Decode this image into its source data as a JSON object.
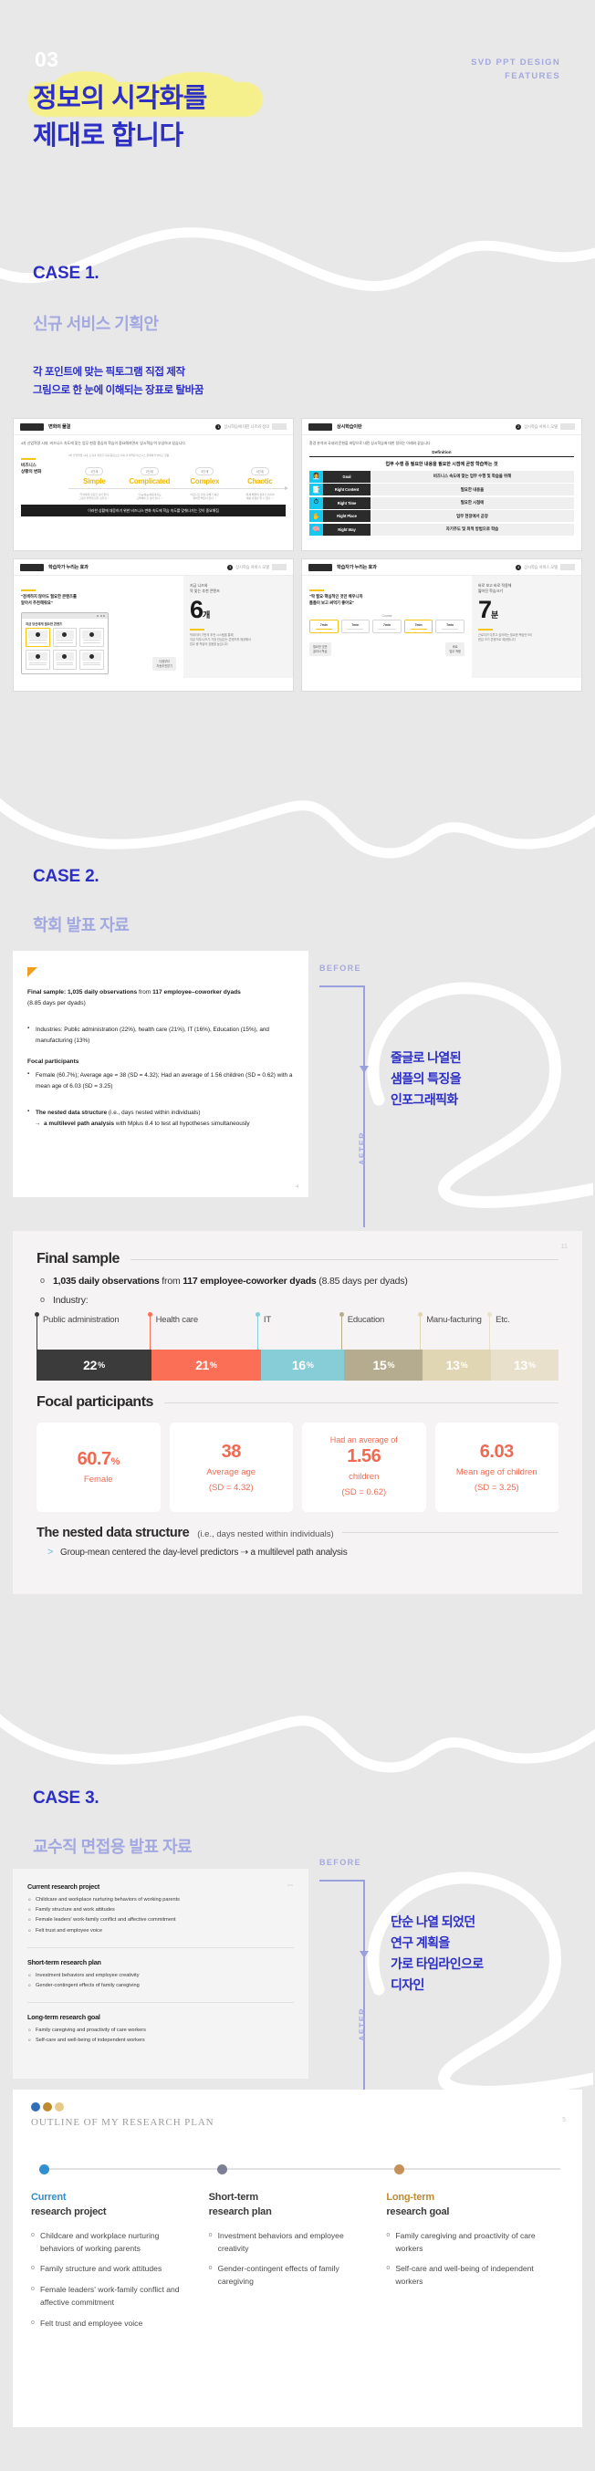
{
  "header": {
    "number": "03",
    "brand_line1": "SVD PPT DESIGN",
    "brand_line2": "FEATURES",
    "hero_line1": "정보의 시각화를",
    "hero_line2": "제대로 합니다"
  },
  "colors": {
    "accent_blue": "#2d2fc4",
    "accent_lavender": "#a3a8e0",
    "highlight_yellow": "#f6f08c",
    "coral": "#ef6a52",
    "teal": "#86cdd8",
    "khaki": "#b5ab8e",
    "sand": "#e0d6b4",
    "dark": "#3b3b3b"
  },
  "case1": {
    "number": "CASE 1.",
    "subtitle": "신규 서비스 기획안",
    "desc_line1": "각 포인트에 맞는 픽토그램 직접 제작",
    "desc_line2": "그림으로 한 눈에  이해되는 장표로 탈바꿈",
    "thumbs": [
      {
        "title": "변화의 물결",
        "badge": "1",
        "badge_label": "상시학습에 대한 니즈와 정의",
        "lead": "4차 산업혁명 시대, 비즈니스 속도에 맞는 업무 현장 중심의 학습이 중요해지면서 '상시학습'이 부상하고 있습니다.",
        "side_label": "비즈니스\n상황의 변화",
        "flow_caption": "4차 산업혁명 시대, 조직과 개인은 다음 중심으로 더욱 더 어려운 비즈니스 문제에 부딪히고 있음",
        "stages": [
          {
            "pill": "1단계",
            "word": "Simple",
            "note": "\"우리에게 필요한 것이 뭔지,\n그것을 어떻게 만들 것인지...\""
          },
          {
            "pill": "2단계",
            "word": "Complicated",
            "note": "\"기능/성능/비용까지도\n고려해야 할 것이 많다...\""
          },
          {
            "pill": "3단계",
            "word": "Complex",
            "note": "\"비즈니스 환경 자체가 복잡,\n명확한 해답이 없다...\""
          },
          {
            "pill": "4단계",
            "word": "Chaotic",
            "note": "\"문제 해결의 성과가 커지며\n예상 반응을 알 수 없다...\""
          }
        ],
        "footer": "이러한 상황에 대응하기 위한 비즈니스 변화 속도에 학습 속도를 맞춰나가는 것이 중요해짐"
      },
      {
        "title": "상시학습이란",
        "badge": "2",
        "badge_label": "상시학습 서비스 모델",
        "lead": "환경 분석과 국내외 문헌을 바탕으로 내린 상시학습에 대한 정의는 아래와 같습니다.",
        "def_title": "Definition",
        "def_main": "업무 수행 중 필요한 내용을 필요한 시점에 곧장 학습하는 것",
        "rows": [
          {
            "icon": "👩‍💼",
            "icon_bg": "#14c8f0",
            "label": "Goal",
            "value": "비즈니스 속도에 맞는 업무 수행 및 학습을 위해"
          },
          {
            "icon": "📑",
            "icon_bg": "#14c8f0",
            "label": "Right Content",
            "value": "필요한 내용을"
          },
          {
            "icon": "⏱",
            "icon_bg": "#14c8f0",
            "label": "Right Time",
            "value": "필요한 시점에"
          },
          {
            "icon": "✋",
            "icon_bg": "#14c8f0",
            "label": "Right Place",
            "value": "업무 현장에서 곧장"
          },
          {
            "icon": "🧠",
            "icon_bg": "#14c8f0",
            "label": "Right Way",
            "value": "자기주도 및 최적 방법으로 학습"
          }
        ]
      },
      {
        "title": "학습자가 누리는 효과",
        "badge": "3",
        "badge_label": "상시학습 서비스 모델",
        "quote": "\"검색하지 않아도 필요한 콘텐츠를\n알아서 추천해줘요\"",
        "screen_title": "지금 당신에게 필요한 콘텐츠",
        "screen_tag": "다음부터\n자동추천받기",
        "right_top": "지금 니즈와\n딱 맞는 추천 콘텐츠",
        "big": "6",
        "big_unit": "개",
        "right_note": "빅데이터 기반의 추천 시스템을 통해\n지금 직무/니즈가 가장 관심있는 콘텐츠를 제공해서\n업무 중 학습의 효율을 높입니다"
      },
      {
        "title": "학습자가 누리는 효과",
        "badge": "4",
        "badge_label": "상시학습 서비스 모델",
        "quote": "\"딱 필요·핵심적인 것만 배우니까\n틈틈이 보고 써먹기 좋아요\"",
        "course_label": "Course",
        "nodes": [
          "7min",
          "7min",
          "7min",
          "7min",
          "7min"
        ],
        "tag_left": "필요한 것만\n골라서 학습",
        "tag_right": "바로\n업무 적용",
        "right_top": "바로 보고 바로 적용해\n짧아진 학습크기",
        "big": "7",
        "big_unit": "분",
        "right_note": "근로자가 다루고 싶어하는 필요한 핵심만 9의\n한입 크기 콘텐츠로 제공합니다"
      }
    ]
  },
  "case2": {
    "number": "CASE 2.",
    "subtitle": "학회 발표 자료",
    "before_label": "BEFORE",
    "after_label": "AFTER",
    "callout_line1": "줄글로 나열된",
    "callout_line2": "샘플의 특징을",
    "callout_line3": "인포그래픽화",
    "before_slide": {
      "page_no": "4",
      "headline_bold1": "Final sample: 1,035 daily observations",
      "headline_normal": " from ",
      "headline_bold2": "117 employee–coworker dyads",
      "headline_line2": "(8.85 days per dyads)",
      "bullet_industries": "Industries: Public administration (22%), health care (21%), IT (16%), Education (15%), and manufacturing (13%)",
      "section_focal": "Focal participants",
      "bullet_focal": "Female (60.7%); Average age = 38 (SD = 4.32); Had an average of 1.56 children (SD = 0.62) with a mean age of 6.03 (SD = 3.25)",
      "bullet_nested_bold": "The nested data structure",
      "bullet_nested_rest": " (i.e., days nested within individuals)",
      "bullet_nested_sub_bold": "a multilevel path analysis",
      "bullet_nested_sub_rest": " with Mplus 8.4 to test all hypotheses simultaneously"
    },
    "after_slide": {
      "page_no": "11",
      "section1_title": "Final sample",
      "line1_bold_a": "1,035 daily observations",
      "line1_mid": " from ",
      "line1_bold_b": "117 employee-coworker dyads",
      "line1_tail": " (8.85 days per dyads)",
      "line2": "Industry:",
      "section2_title": "Focal participants",
      "nested_title": "The nested data structure",
      "nested_sub": "(i.e., days nested within individuals)",
      "nested_bullet": "Group-mean centered the day-level predictors   ⇢ a multilevel path analysis"
    },
    "chart_data": {
      "type": "bar",
      "orientation": "stacked-horizontal",
      "title": "Industry",
      "categories": [
        "Public administration",
        "Health care",
        "IT",
        "Education",
        "Manu-facturing",
        "Etc."
      ],
      "values": [
        22,
        21,
        16,
        15,
        13,
        13
      ],
      "value_labels": [
        "22%",
        "21%",
        "16%",
        "15%",
        "13%",
        "13%"
      ],
      "colors": [
        "#3b3b3b",
        "#fa6f55",
        "#86cdd8",
        "#b5ab8e",
        "#e0d6b4",
        "#e8e0ca"
      ],
      "unit": "%",
      "xlabel": "",
      "ylabel": "",
      "legend": "inline-labels"
    },
    "focal_cards": [
      {
        "pre": "",
        "num": "60.7",
        "unit": "%",
        "label": "Female",
        "sd": ""
      },
      {
        "pre": "",
        "num": "38",
        "unit": "",
        "label": "Average age",
        "sd": "(SD = 4.32)"
      },
      {
        "pre": "Had an average of",
        "num": "1.56",
        "unit": "",
        "label": "children",
        "sd": "(SD = 0.62)"
      },
      {
        "pre": "",
        "num": "6.03",
        "unit": "",
        "label": "Mean age of children",
        "sd": "(SD = 3.25)"
      }
    ]
  },
  "case3": {
    "number": "CASE 3.",
    "subtitle": "교수직 면접용 발표 자료",
    "before_label": "BEFORE",
    "after_label": "AFTER",
    "callout_line1": "단순 나열 되었던",
    "callout_line2": "연구 계획을",
    "callout_line3": "가로 타임라인으로",
    "callout_line4": "디자인",
    "before_slide": {
      "groups": [
        {
          "heading": "Current research project",
          "items": [
            "Childcare and workplace nurturing behaviors of working parents",
            "Family structure and work attitudes",
            "Female leaders' work-family conflict and affective commitment",
            "Felt trust and employee voice"
          ]
        },
        {
          "heading": "Short-term research plan",
          "items": [
            "Investment behaviors and employee creativity",
            "Gender-contingent effects of family caregiving"
          ]
        },
        {
          "heading": "Long-term research goal",
          "items": [
            "Family caregiving and proactivity of care workers",
            "Self-care and well-being of independent workers"
          ]
        }
      ]
    },
    "after_slide": {
      "page_no": "5",
      "title": "OUTLINE OF MY RESEARCH PLAN",
      "dot_colors": [
        "#2f6fb5",
        "#c08a2e",
        "#e8c98a"
      ],
      "columns": [
        {
          "key": "Current",
          "key_color": "#2f8fd0",
          "sub": "research project",
          "node_color": "#2f8fd0",
          "items": [
            "Childcare and workplace nurturing behaviors of working parents",
            "Family structure and work attitudes",
            "Female leaders' work-family conflict and affective commitment",
            "Felt trust and employee voice"
          ]
        },
        {
          "key": "Short-term",
          "key_color": "#3b3b3b",
          "sub": "research plan",
          "node_color": "#7d7f95",
          "items": [
            "Investment behaviors and employee creativity",
            "Gender-contingent effects of family caregiving"
          ]
        },
        {
          "key": "Long-term",
          "key_color": "#c08a2e",
          "sub": "research goal",
          "node_color": "#c4915a",
          "items": [
            "Family caregiving and proactivity of care workers",
            "Self-care and well-being of independent workers"
          ]
        }
      ]
    }
  }
}
